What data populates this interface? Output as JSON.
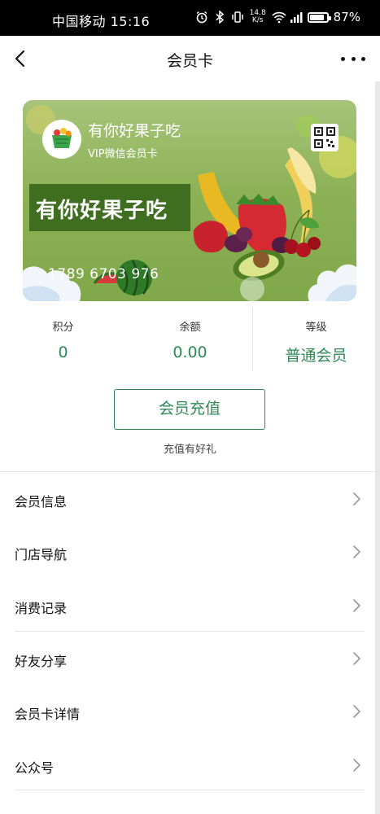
{
  "status_bar": {
    "carrier_time": "中国移动 15:16",
    "net_speed_value": "14.8",
    "net_speed_unit": "K/s",
    "battery_percent": "87%",
    "battery_level": 0.87,
    "icons": [
      "alarm-icon",
      "bluetooth-icon",
      "vibrate-icon",
      "wifi-icon",
      "signal-icon",
      "battery-icon"
    ]
  },
  "nav": {
    "title": "会员卡",
    "back_icon": "chevron-left-icon",
    "more_icon": "more-dots-icon"
  },
  "card": {
    "name": "有你好果子吃",
    "subtitle": "VIP微信会员卡",
    "banner_text": "有你好果子吃",
    "number": "1789 6703 976",
    "qr_icon": "qr-code-icon",
    "colors": {
      "background": "#8db256",
      "banner": "#3f6e21"
    }
  },
  "stats": [
    {
      "label": "积分",
      "value": "0"
    },
    {
      "label": "余额",
      "value": "0.00"
    },
    {
      "label": "等级",
      "value": "普通会员"
    }
  ],
  "recharge": {
    "button_label": "会员充值",
    "note": "充值有好礼"
  },
  "menu": [
    {
      "label": "会员信息"
    },
    {
      "label": "门店导航"
    },
    {
      "label": "消费记录"
    },
    {
      "label": "好友分享"
    },
    {
      "label": "会员卡详情"
    },
    {
      "label": "公众号"
    }
  ],
  "theme": {
    "accent": "#2d8a57",
    "divider": "#e3e3e3"
  }
}
